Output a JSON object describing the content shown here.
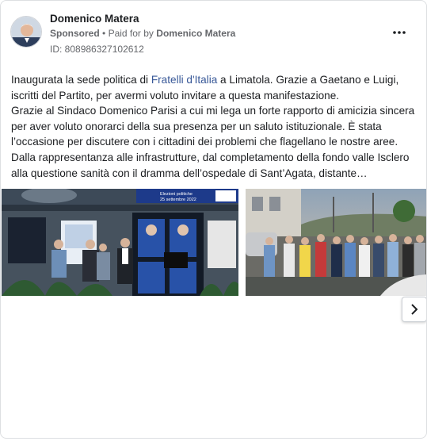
{
  "ad": {
    "page_name": "Domenico Matera",
    "sponsored": "Sponsored",
    "separator": "•",
    "paid_for_prefix": "Paid for by",
    "paid_for_name": "Domenico Matera",
    "id_line": "ID: 808986327102612",
    "more_icon": "more-horizontal-icon",
    "body_part1": "Inaugurata la sede politica di ",
    "body_link": "Fratelli d'Italia",
    "body_part2": " a Limatola. Grazie a Gaetano e Luigi, iscritti del Partito, per avermi voluto invitare a questa manifestazione.",
    "body_part3": "Grazie al Sindaco Domenico Parisi a cui mi lega un forte rapporto di amicizia sincera per aver voluto onorarci della sua presenza per un saluto istituzionale. È stata l’occasione per discutere con i cittadini dei problemi che flagellano le nostre aree. Dalla rappresentanza alle infrastrutture, dal completamento della fondo valle Isclero alla questione sanità con il dramma dell’ospedale di Sant’Agata, distante…",
    "photo1_banner": "Elezioni politiche 25 settembre 2022",
    "next_icon": "chevron-right-icon"
  },
  "colors": {
    "link": "#385898",
    "muted": "#65676b",
    "banner": "#1d3a8a"
  }
}
